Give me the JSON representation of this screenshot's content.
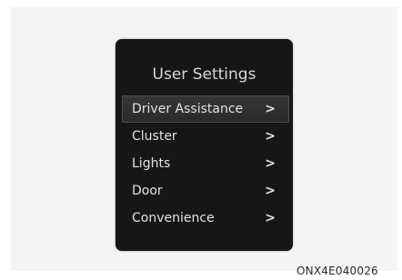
{
  "screen": {
    "title": "User Settings",
    "items": [
      {
        "label": "Driver Assistance",
        "chevron": ">",
        "selected": true
      },
      {
        "label": "Cluster",
        "chevron": ">"
      },
      {
        "label": "Lights",
        "chevron": ">"
      },
      {
        "label": "Door",
        "chevron": ">"
      },
      {
        "label": "Convenience",
        "chevron": ">"
      }
    ]
  },
  "figure_code": "ONX4E040026"
}
